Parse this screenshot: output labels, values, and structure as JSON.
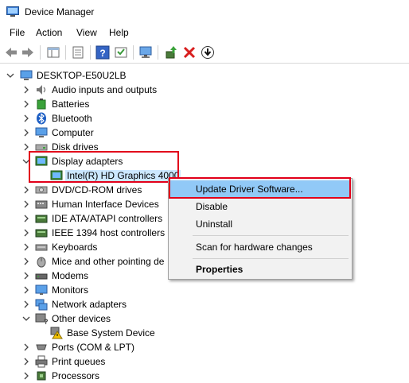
{
  "window": {
    "title": "Device Manager"
  },
  "menu": [
    "File",
    "Action",
    "View",
    "Help"
  ],
  "tree": {
    "root": "DESKTOP-E50U2LB",
    "items": [
      {
        "label": "Audio inputs and outputs",
        "icon": "speaker-icon"
      },
      {
        "label": "Batteries",
        "icon": "battery-icon"
      },
      {
        "label": "Bluetooth",
        "icon": "bluetooth-icon"
      },
      {
        "label": "Computer",
        "icon": "computer-icon"
      },
      {
        "label": "Disk drives",
        "icon": "disk-icon"
      },
      {
        "label": "Display adapters",
        "icon": "display-adapter-icon"
      },
      {
        "label": "Intel(R) HD Graphics 4000",
        "icon": "display-adapter-icon"
      },
      {
        "label": "DVD/CD-ROM drives",
        "icon": "dvd-icon"
      },
      {
        "label": "Human Interface Devices",
        "icon": "hid-icon"
      },
      {
        "label": "IDE ATA/ATAPI controllers",
        "icon": "ide-icon"
      },
      {
        "label": "IEEE 1394 host controllers",
        "icon": "ieee-icon"
      },
      {
        "label": "Keyboards",
        "icon": "keyboard-icon"
      },
      {
        "label": "Mice and other pointing de",
        "icon": "mouse-icon"
      },
      {
        "label": "Modems",
        "icon": "modem-icon"
      },
      {
        "label": "Monitors",
        "icon": "monitor-icon"
      },
      {
        "label": "Network adapters",
        "icon": "network-icon"
      },
      {
        "label": "Other devices",
        "icon": "other-devices-icon"
      },
      {
        "label": "Base System Device",
        "icon": "warning-icon"
      },
      {
        "label": "Ports (COM & LPT)",
        "icon": "port-icon"
      },
      {
        "label": "Print queues",
        "icon": "printer-icon"
      },
      {
        "label": "Processors",
        "icon": "processor-icon"
      }
    ]
  },
  "context_menu": {
    "update": "Update Driver Software...",
    "disable": "Disable",
    "uninstall": "Uninstall",
    "scan": "Scan for hardware changes",
    "properties": "Properties"
  },
  "colors": {
    "highlight_red": "#e2001a",
    "menu_hover": "#91c9f7",
    "selection": "#cce8ff"
  }
}
